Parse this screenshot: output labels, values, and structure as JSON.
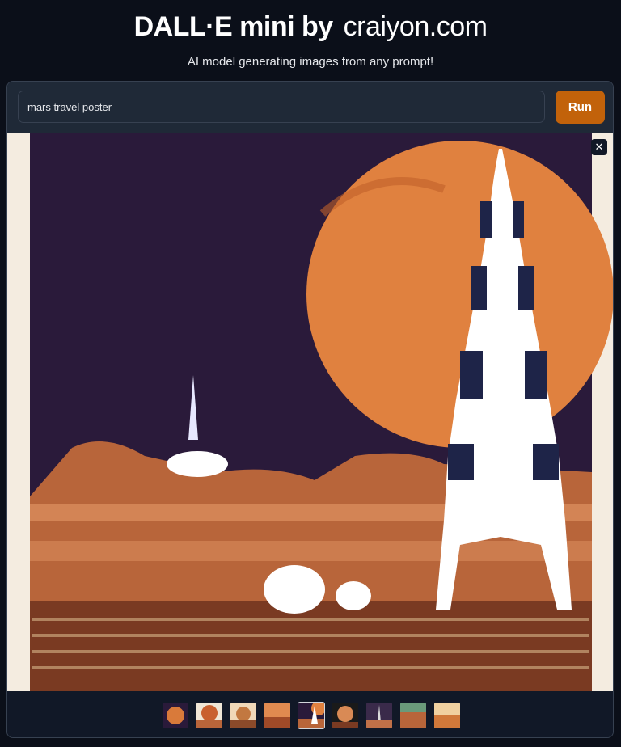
{
  "header": {
    "title_prefix": "DALL·E mini by",
    "title_link": "craiyon.com",
    "subtitle": "AI model generating images from any prompt!"
  },
  "prompt": {
    "value": "mars travel poster",
    "placeholder": ""
  },
  "run_button": {
    "label": "Run"
  },
  "gallery": {
    "close_label": "✕",
    "selected_index": 4,
    "thumbnail_count": 9
  },
  "colors": {
    "background": "#0b0f19",
    "panel": "#111827",
    "accent": "#c2620a",
    "sky": "#2a1a3a",
    "planet": "#e0813f",
    "ground": "#b8653a"
  }
}
